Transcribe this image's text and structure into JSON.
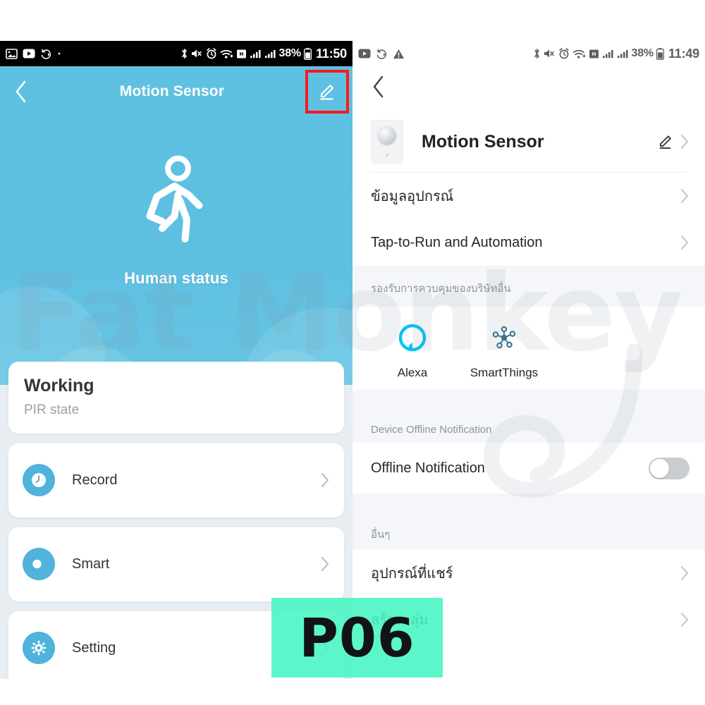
{
  "left_phone": {
    "statusbar": {
      "left_icons": [
        "image-icon",
        "video-icon",
        "sync-icon",
        "dot-icon"
      ],
      "right_icons": [
        "bluetooth-icon",
        "mute-icon",
        "alarm-icon",
        "wifi-icon",
        "hd-icon",
        "signal-icon",
        "signal2-icon"
      ],
      "battery_percent": "38%",
      "time": "11:50"
    },
    "navbar": {
      "back_icon": "chevron-left-icon",
      "title": "Motion Sensor",
      "edit_icon": "pencil-edit-icon",
      "highlight_color": "#FF1A1A"
    },
    "hero": {
      "status_icon": "walking-person-icon",
      "status_label": "Human status",
      "background_color": "#5DBFE1"
    },
    "status_card": {
      "title": "Working",
      "subtitle": "PIR state"
    },
    "menu_rows": [
      {
        "label": "Record",
        "icon": "clock-icon",
        "chevron": "chevron-right-icon"
      },
      {
        "label": "Smart",
        "icon": "scene-icon",
        "chevron": "chevron-right-icon"
      },
      {
        "label": "Setting",
        "icon": "gear-icon",
        "chevron": "chevron-right-icon"
      }
    ],
    "row_icon_color": "#4FB3DC"
  },
  "right_phone": {
    "statusbar": {
      "left_icons": [
        "video-icon",
        "sync-icon",
        "warning-icon"
      ],
      "right_icons": [
        "bluetooth-icon",
        "mute-icon",
        "alarm-icon",
        "wifi-icon",
        "hd-icon",
        "signal-icon",
        "signal2-icon"
      ],
      "battery_percent": "38%",
      "time": "11:49"
    },
    "navbar": {
      "back_icon": "chevron-left-icon"
    },
    "device_header": {
      "thumbnail_icon": "pir-sensor-device-icon",
      "name": "Motion Sensor",
      "edit_icon": "pencil-edit-icon",
      "chevron": "chevron-right-icon"
    },
    "items_top": [
      {
        "label": "ข้อมูลอุปกรณ์",
        "chevron": "chevron-right-icon"
      },
      {
        "label": "Tap-to-Run and Automation",
        "chevron": "chevron-right-icon"
      }
    ],
    "third_party": {
      "section_title": "รองรับการควบคุมของบริษัทอื่น",
      "tiles": [
        {
          "label": "Alexa",
          "icon": "alexa-icon",
          "color": "#00C3F0"
        },
        {
          "label": "SmartThings",
          "icon": "smartthings-icon",
          "color": "#2C6E8F"
        }
      ]
    },
    "offline": {
      "section_title": "Device Offline Notification",
      "row_label": "Offline Notification",
      "toggle_state": "off"
    },
    "others": {
      "section_title": "อื่นๆ",
      "items": [
        {
          "label": "อุปกรณ์ที่แชร์",
          "chevron": "chevron-right-icon"
        },
        {
          "label": "สร้างกลุ่ม",
          "chevron": "chevron-right-icon"
        }
      ]
    }
  },
  "watermark": {
    "text": "Fat Monkey"
  },
  "badge": {
    "label": "P06",
    "background_color": "#46F5C3"
  }
}
